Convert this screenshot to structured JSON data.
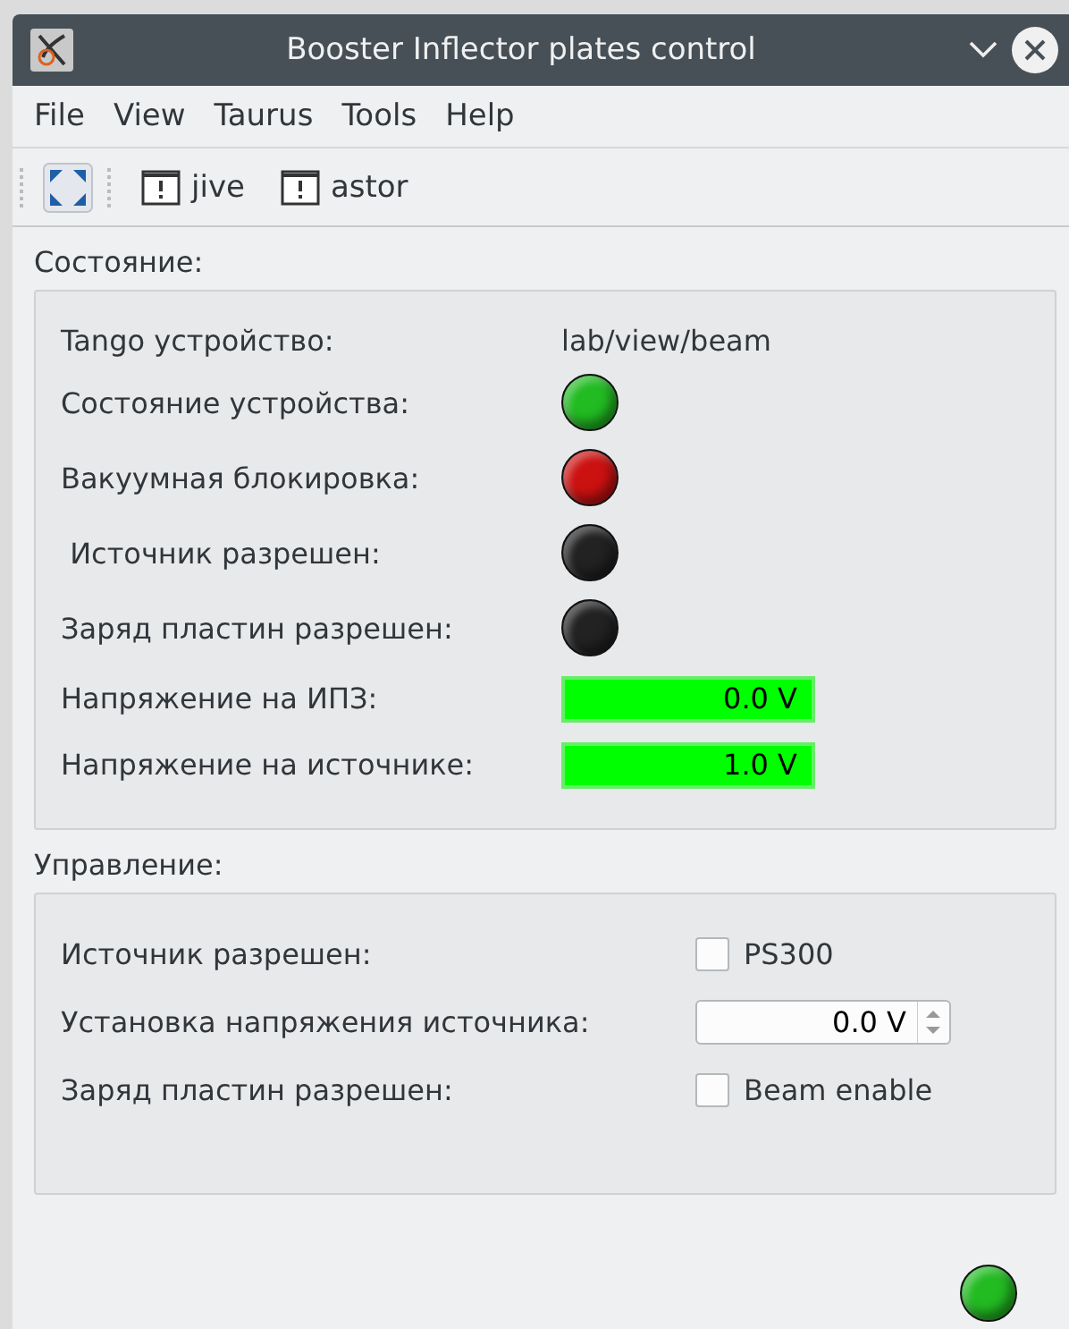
{
  "window": {
    "title": "Booster Inflector plates control"
  },
  "menu": [
    "File",
    "View",
    "Taurus",
    "Tools",
    "Help"
  ],
  "toolbar": [
    "jive",
    "astor"
  ],
  "status_group": {
    "title": "Состояние:",
    "rows": [
      {
        "kind": "text",
        "label": "Tango устройство:",
        "value": "lab/view/beam"
      },
      {
        "kind": "led",
        "label": "Состояние устройства:",
        "color": "#22bb22"
      },
      {
        "kind": "led",
        "label": "Вакуумная блокировка:",
        "color": "#cc1111"
      },
      {
        "kind": "led",
        "label": " Источник разрешен:",
        "color": "#222222"
      },
      {
        "kind": "led",
        "label": "Заряд пластин разрешен:",
        "color": "#222222"
      },
      {
        "kind": "reading",
        "label": "Напряжение на ИПЗ:",
        "value": "0.0 V"
      },
      {
        "kind": "reading",
        "label": "Напряжение на источнике:",
        "value": "1.0 V"
      }
    ]
  },
  "control_group": {
    "title": "Управление:",
    "rows": [
      {
        "kind": "checkbox",
        "label": "Источник разрешен:",
        "text": "PS300",
        "checked": false
      },
      {
        "kind": "spinbox",
        "label": "Установка напряжения источника:",
        "value": "0.0 V"
      },
      {
        "kind": "checkbox",
        "label": "Заряд пластин разрешен:",
        "text": "Beam enable",
        "checked": false
      }
    ]
  },
  "status_led": {
    "color": "#22bb22"
  }
}
